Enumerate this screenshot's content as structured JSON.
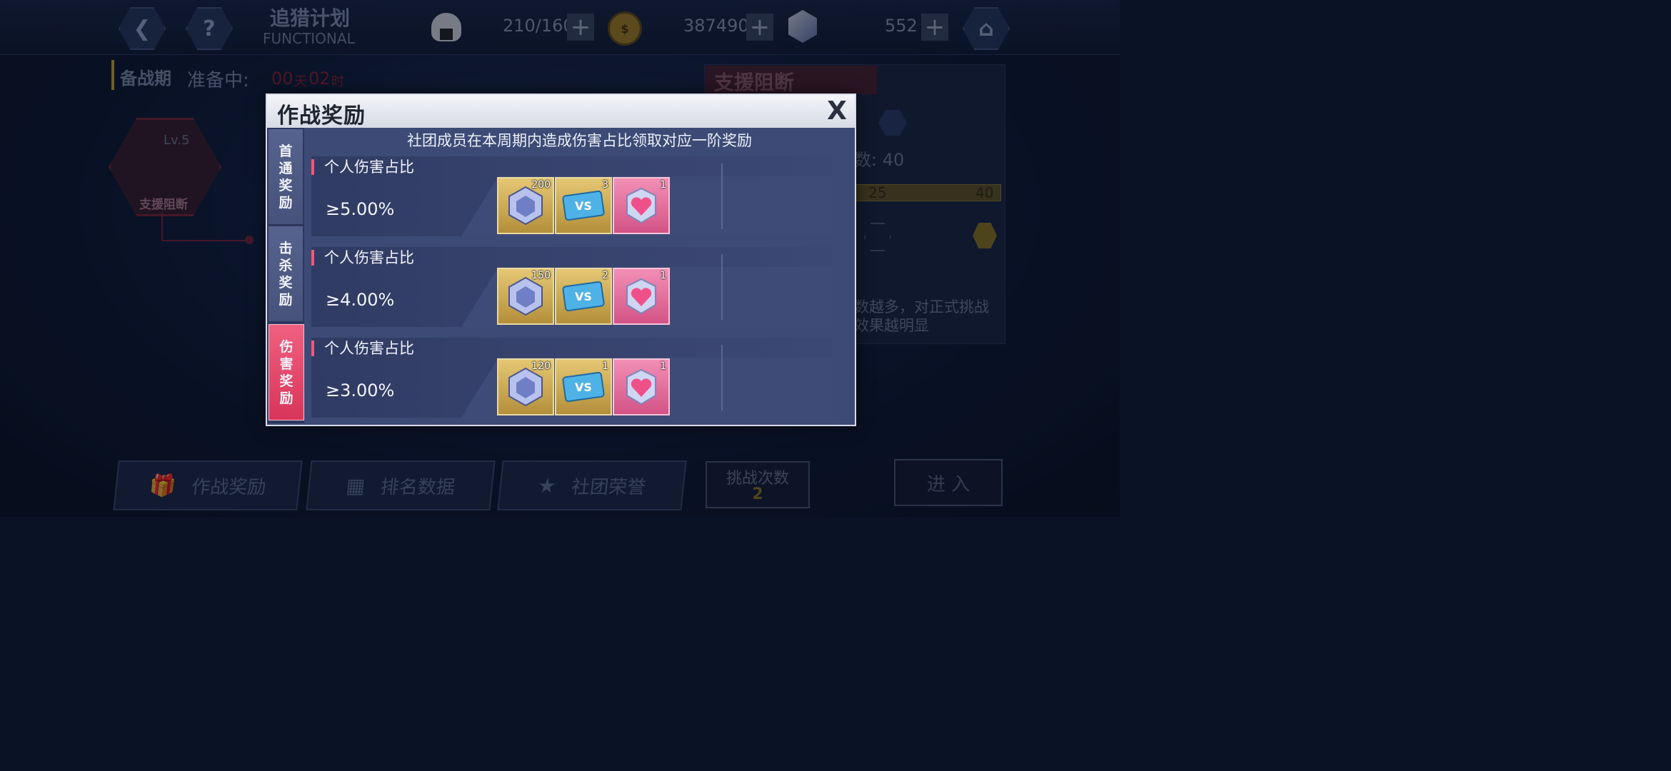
{
  "topbar": {
    "title_cn": "追猎计划",
    "title_en": "FUNCTIONAL",
    "stamina": "210/160",
    "gold": "387490",
    "gems": "552"
  },
  "left_panel": {
    "phase_label": "备战期",
    "countdown_prefix": "准备中:",
    "days": "00",
    "days_unit": "天",
    "hours": "02",
    "hours_unit": "时",
    "boss_level": "Lv.5",
    "boss_name": "支援阻断"
  },
  "right_panel": {
    "title": "支援阻断",
    "count_fragment": "数: 40",
    "progress_ticks": [
      "25",
      "40"
    ],
    "desc_line1": "数越多，对正式挑战",
    "desc_line2": "效果越明显"
  },
  "bottom_bar": {
    "reward_button": "作战奖励",
    "ranking_button": "排名数据",
    "honor_button": "社团荣誉",
    "challenge_label": "挑战次数",
    "challenge_count": "2",
    "enter_button": "进 入"
  },
  "modal": {
    "title": "作战奖励",
    "close": "X",
    "subtitle": "社团成员在本周期内造成伤害占比领取对应一阶奖励",
    "tabs": [
      {
        "chars": [
          "首",
          "通",
          "奖",
          "励"
        ],
        "active": false
      },
      {
        "chars": [
          "击",
          "杀",
          "奖",
          "励"
        ],
        "active": false
      },
      {
        "chars": [
          "伤",
          "害",
          "奖",
          "励"
        ],
        "active": true
      }
    ],
    "rows": [
      {
        "label": "个人伤害占比",
        "threshold": "≥5.00%",
        "items": [
          {
            "icon": "crystal-icon",
            "count": "200"
          },
          {
            "icon": "vs-ticket-icon",
            "count": "3"
          },
          {
            "icon": "heart-badge-icon",
            "count": "1"
          }
        ]
      },
      {
        "label": "个人伤害占比",
        "threshold": "≥4.00%",
        "items": [
          {
            "icon": "crystal-icon",
            "count": "150"
          },
          {
            "icon": "vs-ticket-icon",
            "count": "2"
          },
          {
            "icon": "heart-badge-icon",
            "count": "1"
          }
        ]
      },
      {
        "label": "个人伤害占比",
        "threshold": "≥3.00%",
        "items": [
          {
            "icon": "crystal-icon",
            "count": "120"
          },
          {
            "icon": "vs-ticket-icon",
            "count": "1"
          },
          {
            "icon": "heart-badge-icon",
            "count": "1"
          }
        ]
      }
    ]
  },
  "colors": {
    "accent_pink": "#e8466f",
    "modal_bg": "#3c4a75",
    "item_gold": "#d9b85d"
  }
}
